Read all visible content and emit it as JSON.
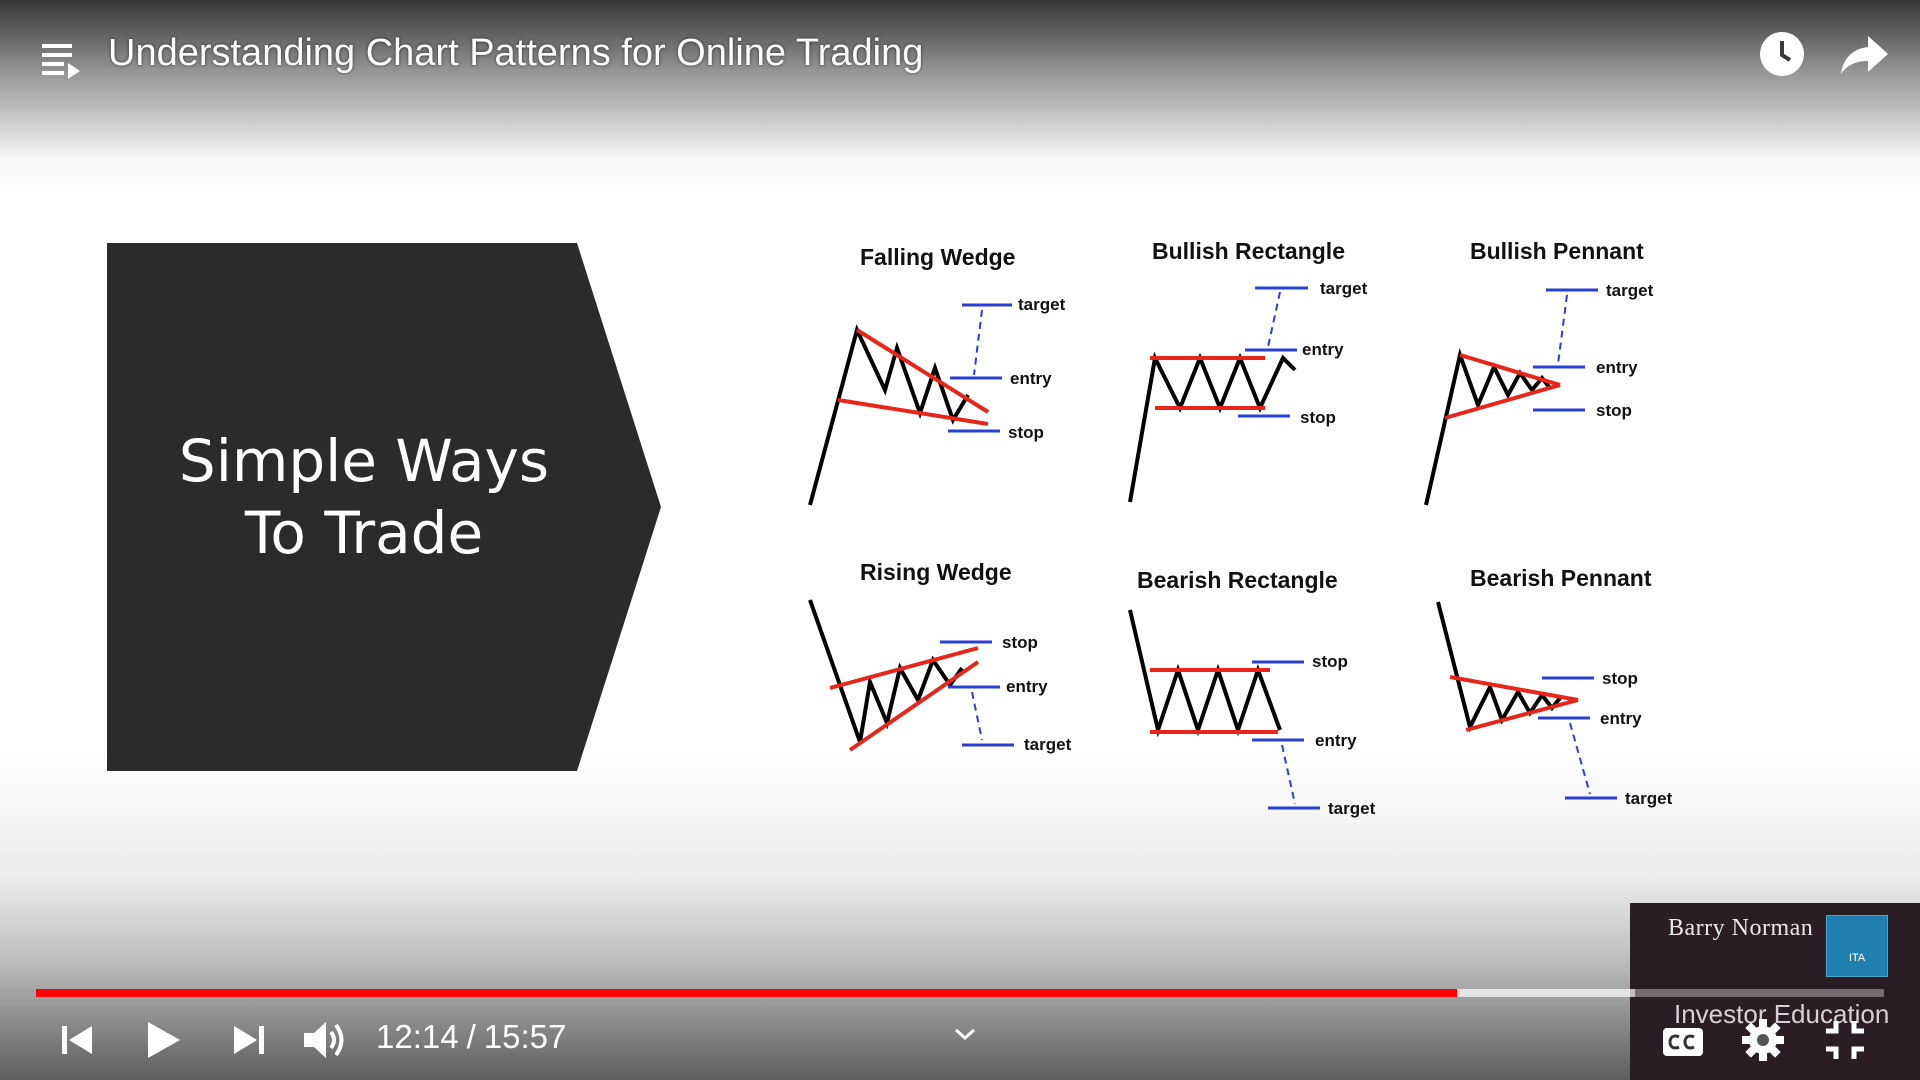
{
  "player": {
    "title": "Understanding Chart Patterns for Online Trading",
    "current_time": "12:14",
    "separator": "/",
    "duration": "15:57",
    "progress_fraction": 0.769,
    "buffered_fraction": 0.865,
    "accent_color": "#ff0000",
    "top_icons": [
      "playlist-icon",
      "clock-icon",
      "share-icon"
    ],
    "control_icons": [
      "previous-icon",
      "play-icon",
      "next-icon",
      "volume-icon",
      "chevron-down-icon",
      "cc-icon",
      "gear-icon",
      "exit-fullscreen-icon"
    ]
  },
  "slide": {
    "line1": "Simple Ways",
    "line2": "To Trade",
    "patterns": {
      "falling_wedge": {
        "title": "Falling Wedge",
        "target": "target",
        "entry": "entry",
        "stop": "stop"
      },
      "bullish_rectangle": {
        "title": "Bullish Rectangle",
        "target": "target",
        "entry": "entry",
        "stop": "stop"
      },
      "bullish_pennant": {
        "title": "Bullish Pennant",
        "target": "target",
        "entry": "entry",
        "stop": "stop"
      },
      "rising_wedge": {
        "title": "Rising Wedge",
        "stop": "stop",
        "entry": "entry",
        "target": "target"
      },
      "bearish_rectangle": {
        "title": "Bearish Rectangle",
        "stop": "stop",
        "entry": "entry",
        "target": "target"
      },
      "bearish_pennant": {
        "title": "Bearish Pennant",
        "stop": "stop",
        "entry": "entry",
        "target": "target"
      }
    }
  },
  "endcard": {
    "name": "Barry Norman",
    "logo_text": "ITA",
    "subtitle": "Investor Education"
  }
}
